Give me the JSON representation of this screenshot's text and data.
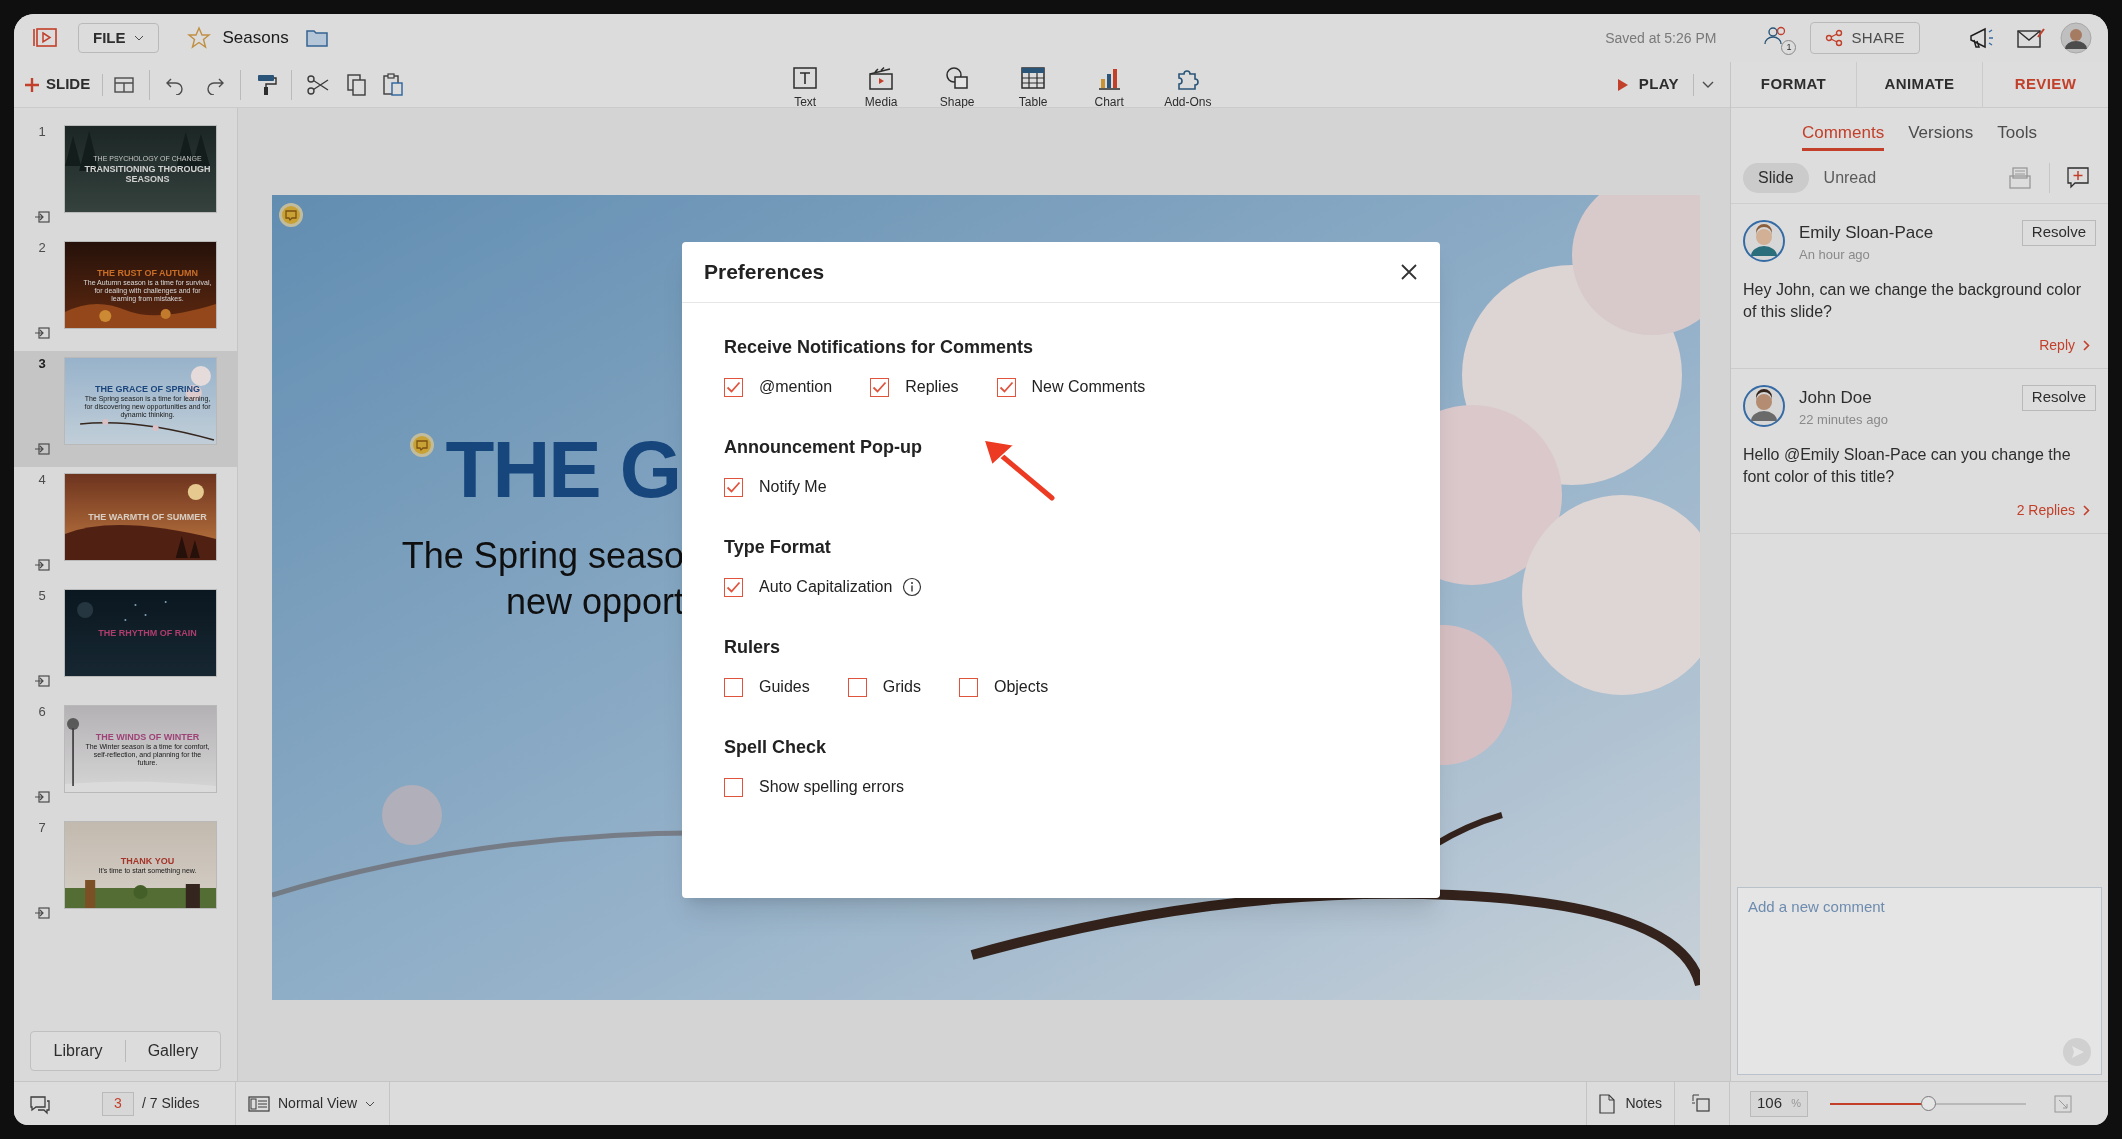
{
  "app_header": {
    "file_menu": "FILE",
    "document_title": "Seasons",
    "saved_status": "Saved at 5:26 PM",
    "collaborators_count": "1",
    "share_button": "SHARE"
  },
  "toolbar": {
    "new_slide": "SLIDE",
    "insert_tools": [
      "Text",
      "Media",
      "Shape",
      "Table",
      "Chart",
      "Add-Ons"
    ],
    "play": "PLAY"
  },
  "panel_tabs": [
    {
      "label": "FORMAT",
      "selected": false
    },
    {
      "label": "ANIMATE",
      "selected": false
    },
    {
      "label": "REVIEW",
      "selected": true
    }
  ],
  "slides": [
    {
      "number": "1",
      "overline": "THE PSYCHOLOGY OF CHANGE",
      "title": "TRANSITIONING THOROUGH SEASONS",
      "selected": false
    },
    {
      "number": "2",
      "title": "THE RUST OF AUTUMN",
      "subtitle": "The Autumn season is a time for survival, for dealing with challenges and for learning from mistakes.",
      "selected": false
    },
    {
      "number": "3",
      "title": "THE GRACE OF SPRING",
      "subtitle": "The Spring season is a time for learning, for discovering new opportunities and for dynamic thinking.",
      "selected": true
    },
    {
      "number": "4",
      "title": "THE WARMTH OF SUMMER",
      "selected": false
    },
    {
      "number": "5",
      "title": "THE RHYTHM OF RAIN",
      "selected": false
    },
    {
      "number": "6",
      "title": "THE WINDS OF WINTER",
      "subtitle": "The Winter season is a time for comfort, self-reflection, and planning for the future.",
      "selected": false
    },
    {
      "number": "7",
      "title": "THANK YOU",
      "subtitle": "It's time to start something new.",
      "selected": false
    }
  ],
  "library_tabs": [
    "Library",
    "Gallery"
  ],
  "slide_canvas": {
    "title": "THE G",
    "body_lines": [
      "The Spring seaso",
      "new opport"
    ]
  },
  "comment_tabs": [
    {
      "label": "Comments",
      "selected": true
    },
    {
      "label": "Versions",
      "selected": false
    },
    {
      "label": "Tools",
      "selected": false
    }
  ],
  "comment_filters": [
    {
      "label": "Slide",
      "selected": true
    },
    {
      "label": "Unread",
      "selected": false
    }
  ],
  "comments": [
    {
      "author": "Emily Sloan-Pace",
      "time": "An hour ago",
      "text": "Hey John, can we change the background color of this slide?",
      "resolve": "Resolve",
      "action": "Reply"
    },
    {
      "author": "John Doe",
      "time": "22 minutes ago",
      "text": "Hello @Emily Sloan-Pace can you change the font color of this title?",
      "resolve": "Resolve",
      "action": "2 Replies"
    }
  ],
  "new_comment": {
    "placeholder": "Add a new comment"
  },
  "status_bar": {
    "current_slide": "3",
    "slide_total": "/ 7 Slides",
    "view": "Normal View",
    "notes": "Notes",
    "zoom": "106",
    "zoom_unit": "%",
    "zoom_slider": {
      "level": 0.5
    }
  },
  "preferences": {
    "title": "Preferences",
    "sections": [
      {
        "heading": "Receive Notifications for Comments",
        "options": [
          {
            "label": "@mention",
            "checked": true
          },
          {
            "label": "Replies",
            "checked": true
          },
          {
            "label": "New Comments",
            "checked": true
          }
        ]
      },
      {
        "heading": "Announcement Pop-up",
        "options": [
          {
            "label": "Notify Me",
            "checked": true
          }
        ]
      },
      {
        "heading": "Type Format",
        "options": [
          {
            "label": "Auto Capitalization",
            "checked": true,
            "info": true
          }
        ]
      },
      {
        "heading": "Rulers",
        "options": [
          {
            "label": "Guides",
            "checked": false
          },
          {
            "label": "Grids",
            "checked": false
          },
          {
            "label": "Objects",
            "checked": false
          }
        ]
      },
      {
        "heading": "Spell Check",
        "options": [
          {
            "label": "Show spelling errors",
            "checked": false
          }
        ]
      }
    ]
  }
}
